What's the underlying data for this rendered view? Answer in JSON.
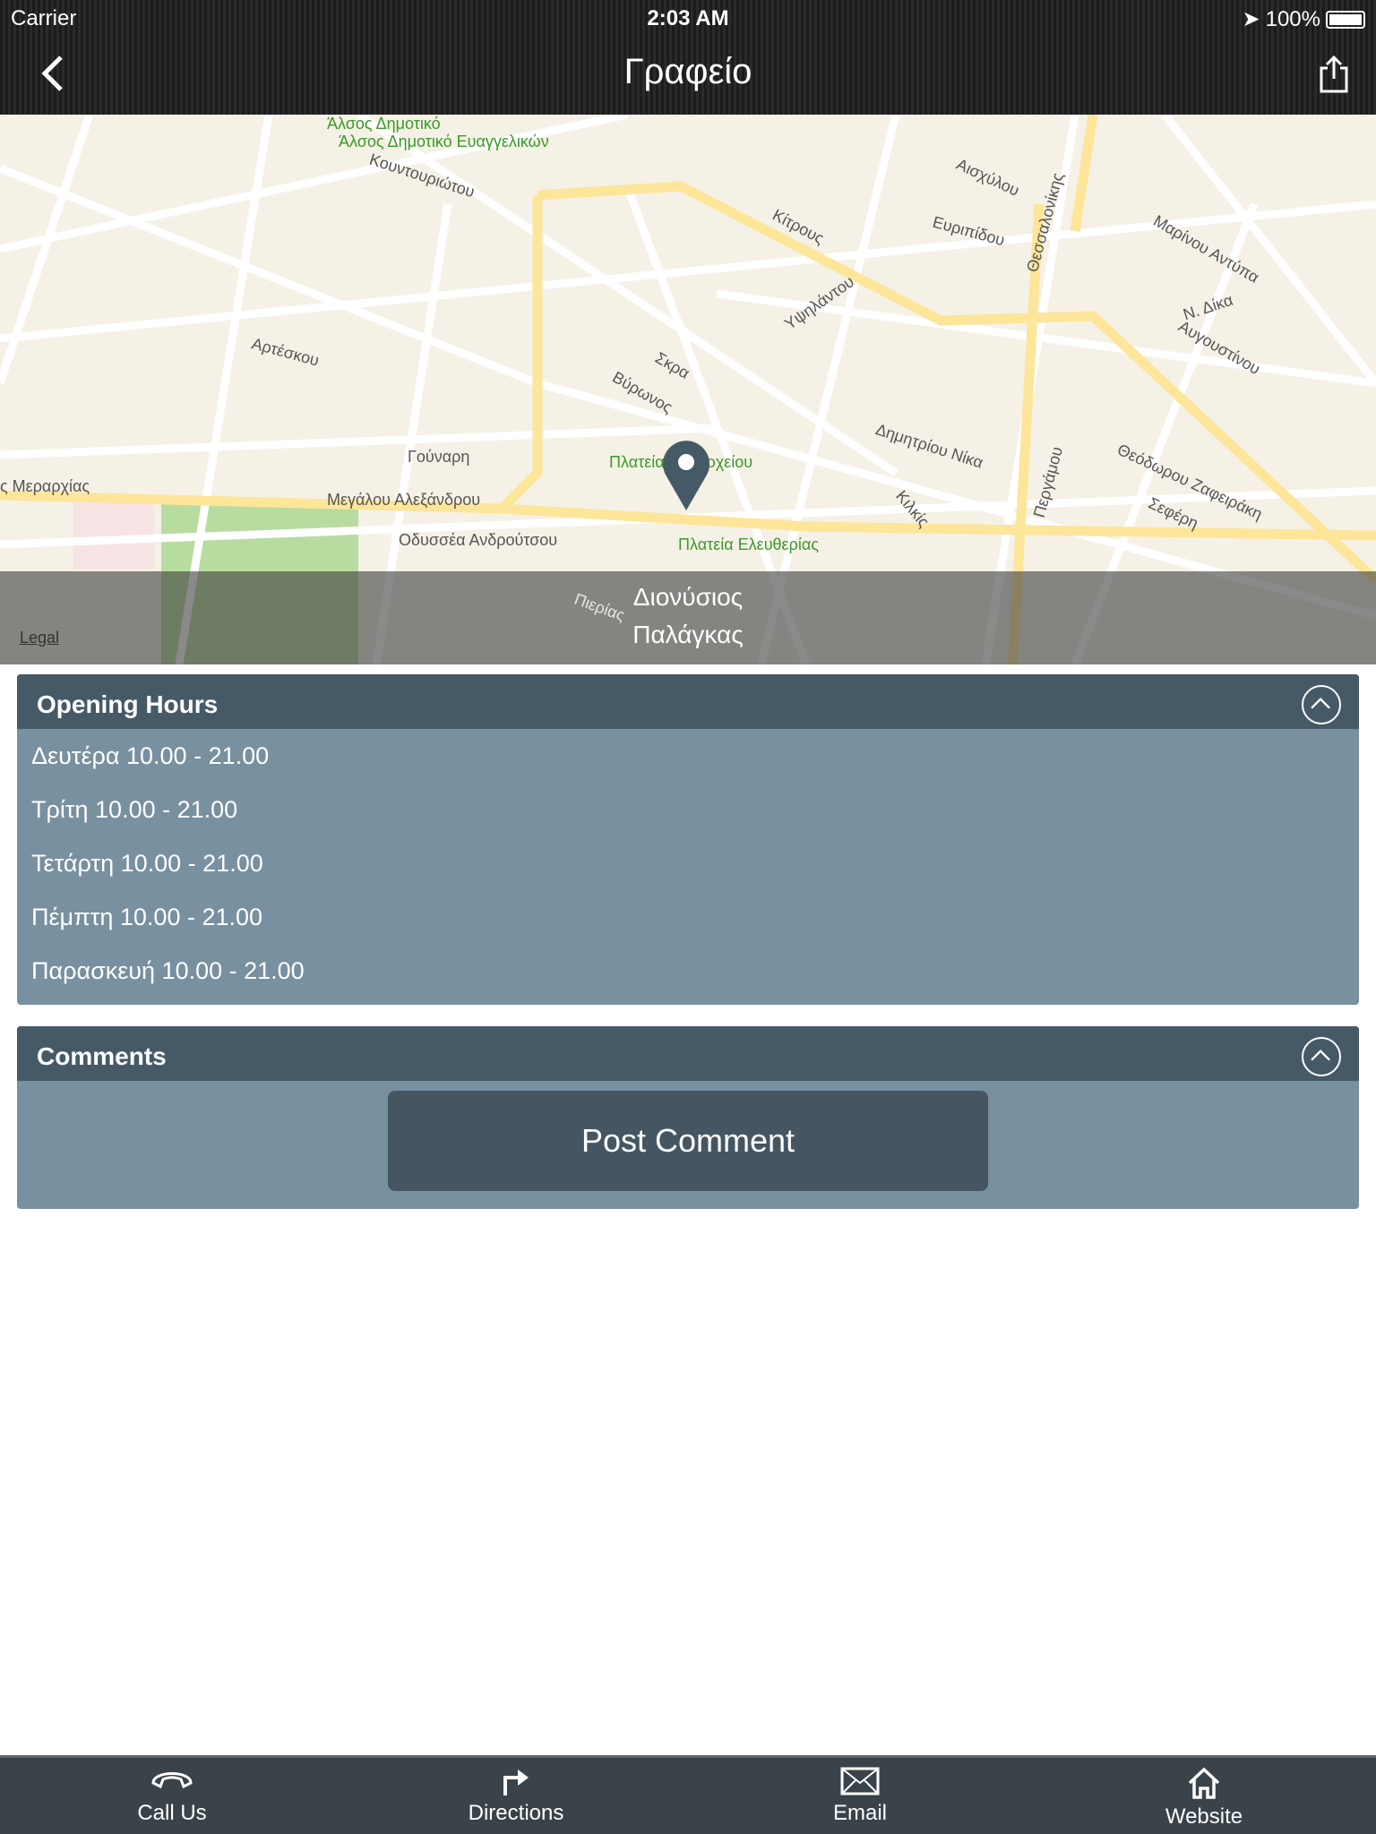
{
  "status": {
    "carrier": "Carrier",
    "time": "2:03 AM",
    "battery": "100%"
  },
  "nav": {
    "title": "Γραφείο"
  },
  "map": {
    "labels": [
      "Άλσος Δημοτικό Ευαγγελικών",
      "Κουντουριώτου",
      "Κίτρους",
      "Ευριπίδου",
      "Αισχύλου",
      "Μαρίνου Αντύπα",
      "Ν. Δίκα",
      "Αυγουστίνου",
      "Αρτέσκου",
      "Γούναρη",
      "Μεγάλου Αλεξάνδρου",
      "Οδυσσέα Ανδρούτσου",
      "Πλατεία Δημαρχείου",
      "Πλατεία Ελευθερίας",
      "Δημητρίου Νίκα",
      "Περγάμου",
      "Θεόδωρου Ζαφειράκη",
      "Σεφέρη",
      "Υψηλάντου",
      "Σκρα",
      "Βύρωνος",
      "ς Μεραρχίας",
      "Πιερίας",
      "Κιλκίς",
      "Θεσσαλονίκης"
    ],
    "place_name": "Διονύσιος Παλάγκας",
    "legal": "Legal",
    "pin_color": "#455a66"
  },
  "opening_hours": {
    "title": "Opening Hours",
    "rows": [
      "Δευτέρα 10.00 - 21.00",
      "Τρίτη 10.00 - 21.00",
      "Τετάρτη 10.00 - 21.00",
      "Πέμπτη 10.00 - 21.00",
      "Παρασκευή 10.00 - 21.00"
    ]
  },
  "comments": {
    "title": "Comments",
    "post_button": "Post Comment"
  },
  "tabs": [
    {
      "label": "Call Us",
      "icon": "phone-icon"
    },
    {
      "label": "Directions",
      "icon": "directions-icon"
    },
    {
      "label": "Email",
      "icon": "envelope-icon"
    },
    {
      "label": "Website",
      "icon": "home-icon"
    }
  ]
}
